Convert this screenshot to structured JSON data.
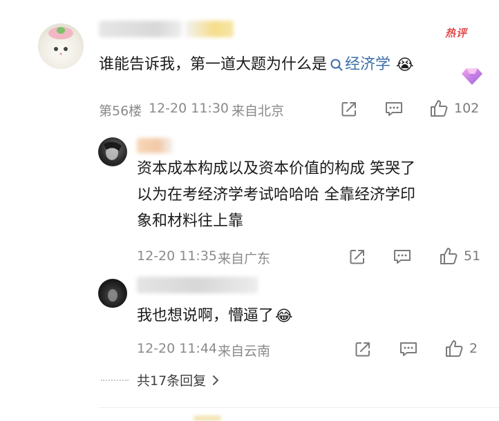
{
  "main_comment": {
    "badge": "热评",
    "text_prefix": "谁能告诉我，第一道大题为什么是",
    "search_icon": "search-icon",
    "topic": "经济学",
    "emoji": "😭",
    "floor": "第56楼",
    "time": "12-20 11:30",
    "location": "来自北京",
    "likes": "102"
  },
  "replies": [
    {
      "lines": [
        "资本成本构成以及资本价值的构成 笑哭了",
        "以为在考经济学考试哈哈哈 全靠经济学印",
        "象和材料往上靠"
      ],
      "time": "12-20 11:35",
      "location": "来自广东",
      "likes": "51"
    },
    {
      "text": "我也想说啊，懵逼了",
      "emoji": "😂",
      "time": "12-20 11:44",
      "location": "来自云南",
      "likes": "2"
    }
  ],
  "more_replies": {
    "label": "共17条回复",
    "chevron": "chevron-right-icon"
  },
  "colors": {
    "badge": "#e14a4a",
    "topic_link": "#3b6ea8",
    "meta": "#8a8a8a"
  }
}
